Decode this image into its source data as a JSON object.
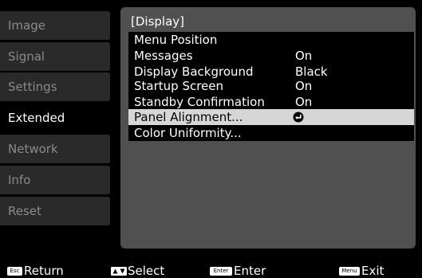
{
  "sidebar": {
    "tabs": [
      {
        "label": "Image"
      },
      {
        "label": "Signal"
      },
      {
        "label": "Settings"
      },
      {
        "label": "Extended"
      },
      {
        "label": "Network"
      },
      {
        "label": "Info"
      },
      {
        "label": "Reset"
      }
    ],
    "active_tab": "Extended"
  },
  "panel": {
    "title": "[Display]",
    "items": [
      {
        "label": "Menu Position",
        "value": ""
      },
      {
        "label": "Messages",
        "value": "On"
      },
      {
        "label": "Display Background",
        "value": "Black"
      },
      {
        "label": "Startup Screen",
        "value": "On"
      },
      {
        "label": "Standby Confirmation",
        "value": "On"
      },
      {
        "label": "Panel Alignment...",
        "value": "",
        "icon": "enter-icon",
        "selected": true
      },
      {
        "label": "Color Uniformity...",
        "value": ""
      }
    ]
  },
  "footer": {
    "return": {
      "key": "Esc",
      "label": "Return"
    },
    "select": {
      "icon": "up-down-arrows-icon",
      "label": "Select"
    },
    "enter": {
      "key": "Enter",
      "label": "Enter"
    },
    "exit": {
      "key": "Menu",
      "label": "Exit"
    }
  },
  "colors": {
    "background": "#000000",
    "tab_inactive": "#2a2a2a",
    "panel": "#505050",
    "selected_row": "#d6d6d6"
  }
}
